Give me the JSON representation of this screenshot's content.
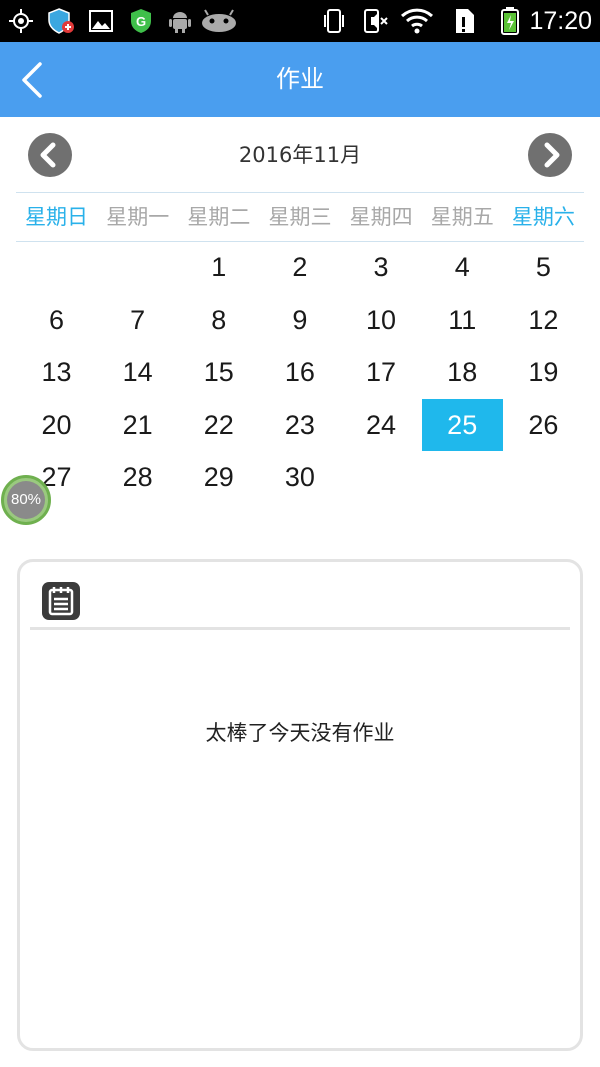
{
  "status_bar": {
    "time": "17:20",
    "icons": [
      "gps-icon",
      "shield-icon",
      "image-icon",
      "app-icon",
      "android-icon",
      "android-game-icon",
      "vibrate-icon",
      "mute-icon",
      "wifi-icon",
      "sim-icon",
      "battery-icon"
    ]
  },
  "app_bar": {
    "title": "作业",
    "back_icon": "chevron-left-icon"
  },
  "calendar": {
    "month_label": "2016年11月",
    "prev_icon": "chevron-left-circle-icon",
    "next_icon": "chevron-right-circle-icon",
    "weekdays": [
      "星期日",
      "星期一",
      "星期二",
      "星期三",
      "星期四",
      "星期五",
      "星期六"
    ],
    "days": [
      "1",
      "2",
      "3",
      "4",
      "5",
      "6",
      "7",
      "8",
      "9",
      "10",
      "11",
      "12",
      "13",
      "14",
      "15",
      "16",
      "17",
      "18",
      "19",
      "20",
      "21",
      "22",
      "23",
      "24",
      "25",
      "26",
      "27",
      "28",
      "29",
      "30"
    ],
    "first_weekday_index": 2,
    "selected_day": "25",
    "weekend_color": "#29b1ea",
    "selected_color": "#1fb8ec"
  },
  "float_badge": {
    "label": "80%"
  },
  "homework": {
    "icon": "notepad-icon",
    "empty_message": "太棒了今天没有作业"
  },
  "colors": {
    "app_bar": "#4a9eef",
    "status_bar": "#000000"
  }
}
